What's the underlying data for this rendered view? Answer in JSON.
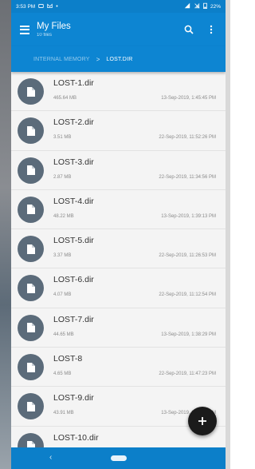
{
  "status_bar": {
    "time": "3:53 PM",
    "battery": "22%",
    "icons": [
      "notification-icon",
      "gmail-icon",
      "dot-icon",
      "signal-icon",
      "wifi-off-icon",
      "battery-icon"
    ]
  },
  "toolbar": {
    "title": "My Files",
    "subtitle": "10 files"
  },
  "breadcrumb": {
    "parent": "INTERNAL MEMORY",
    "separator": ">",
    "current": "LOST.DIR"
  },
  "colors": {
    "primary": "#0d85d2",
    "status_bar": "#0c7fc9",
    "file_icon_bg": "#5b6b7a",
    "fab": "#1b1b1b"
  },
  "files": [
    {
      "name": "LOST-1.dir",
      "size": "465.64 MB",
      "date": "13-Sep-2019, 1:45:45 PM"
    },
    {
      "name": "LOST-2.dir",
      "size": "3.51 MB",
      "date": "22-Sep-2019, 11:52:26 PM"
    },
    {
      "name": "LOST-3.dir",
      "size": "2.87 MB",
      "date": "22-Sep-2019, 11:34:56 PM"
    },
    {
      "name": "LOST-4.dir",
      "size": "48.22 MB",
      "date": "13-Sep-2019, 1:39:13 PM"
    },
    {
      "name": "LOST-5.dir",
      "size": "3.37 MB",
      "date": "22-Sep-2019, 11:26:53 PM"
    },
    {
      "name": "LOST-6.dir",
      "size": "4.07 MB",
      "date": "22-Sep-2019, 11:12:54 PM"
    },
    {
      "name": "LOST-7.dir",
      "size": "44.65 MB",
      "date": "13-Sep-2019, 1:38:29 PM"
    },
    {
      "name": "LOST-8",
      "size": "4.65 MB",
      "date": "22-Sep-2019, 11:47:23 PM"
    },
    {
      "name": "LOST-9.dir",
      "size": "43.91 MB",
      "date": "13-Sep-2019, 1:38:01 PM"
    },
    {
      "name": "LOST-10.dir",
      "size": "",
      "date": ""
    }
  ]
}
